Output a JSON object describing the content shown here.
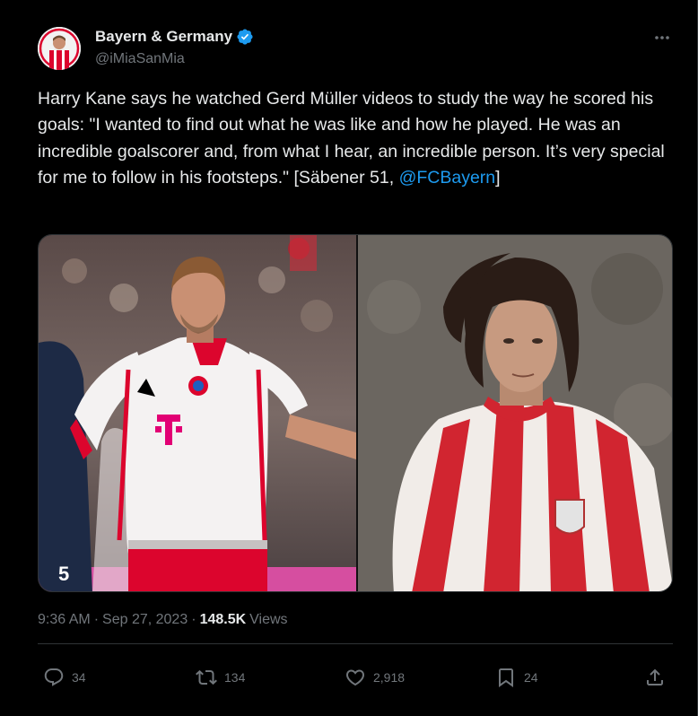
{
  "author": {
    "display_name": "Bayern & Germany",
    "handle": "@iMiaSanMia",
    "verified": true
  },
  "tweet": {
    "text_part1": "Harry Kane says he watched Gerd Müller videos to study the way he scored his goals: \"I wanted to find out what he was like and how he played. He was an incredible goalscorer and, from what I hear, an incredible person. It’s very special for me to follow in his footsteps.\" [Säbener 51, ",
    "mention": "@FCBayern",
    "text_part2": "]"
  },
  "meta": {
    "time": "9:36 AM",
    "dot1": "·",
    "date": "Sep 27, 2023",
    "dot2": "·",
    "views_count": "148.5K",
    "views_label": "Views"
  },
  "actions": {
    "replies": "34",
    "reposts": "134",
    "likes": "2,918",
    "bookmarks": "24"
  },
  "icons": {
    "more": "more-icon",
    "reply": "reply-icon",
    "repost": "repost-icon",
    "like": "heart-icon",
    "bookmark": "bookmark-icon",
    "share": "share-icon",
    "verified": "verified-badge-icon"
  },
  "colors": {
    "background": "#000000",
    "text_primary": "#e7e9ea",
    "text_secondary": "#71767b",
    "accent": "#1d9bf0",
    "divider": "#2f3336",
    "bayern_red": "#dc052d"
  }
}
